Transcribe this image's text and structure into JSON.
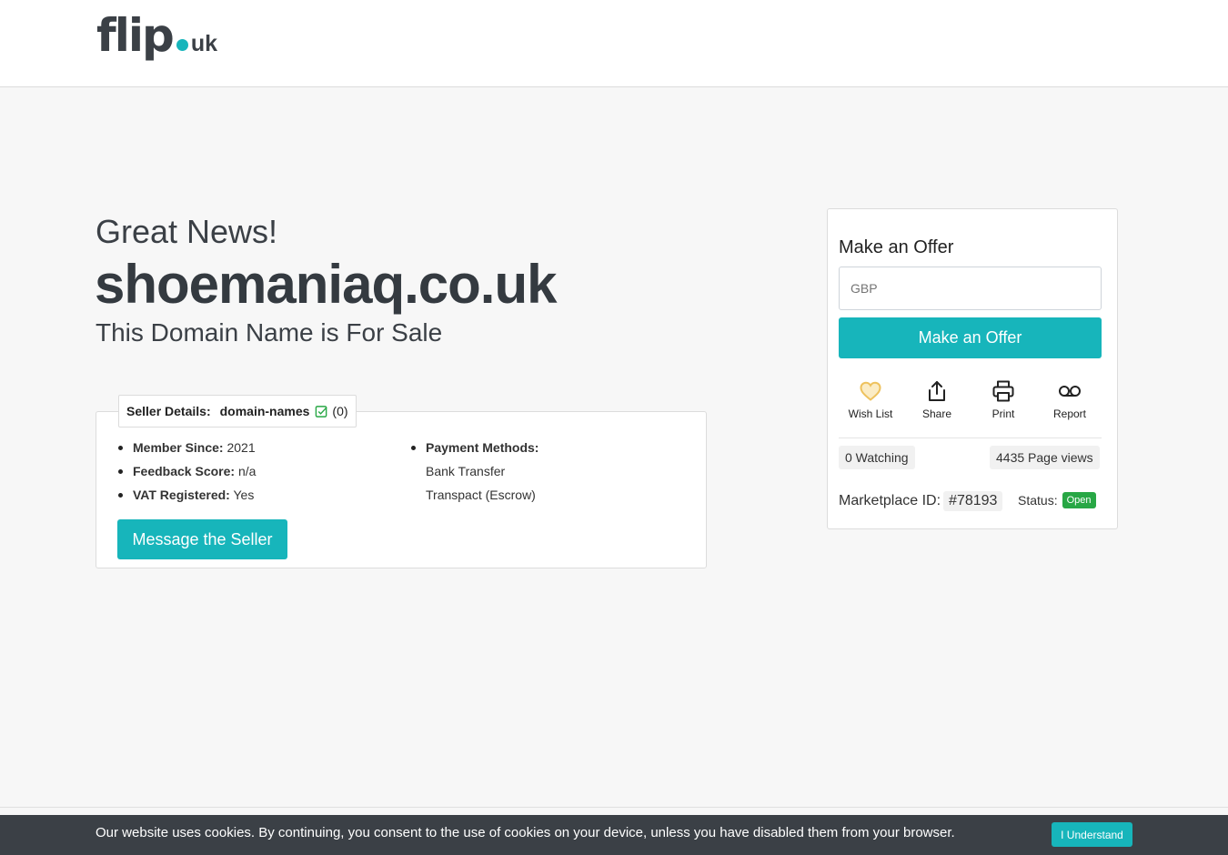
{
  "brand": {
    "name": "flip",
    "tld": "uk",
    "accent": "#17b5bb",
    "dark": "#3b4046"
  },
  "hero": {
    "kicker": "Great News!",
    "domain": "shoemaniaq.co.uk",
    "subtitle": "This Domain Name is For Sale"
  },
  "seller": {
    "details_label": "Seller Details:",
    "name": "domain-names",
    "verified_icon": "check-square-icon",
    "rating": "(0)",
    "facts": [
      {
        "key": "Member Since:",
        "value": "2021"
      },
      {
        "key": "Feedback Score:",
        "value": "n/a"
      },
      {
        "key": "VAT Registered:",
        "value": "Yes"
      }
    ],
    "payment_label": "Payment Methods:",
    "payment_methods": [
      "Bank Transfer",
      "Transpact (Escrow)"
    ],
    "message_button": "Message the Seller"
  },
  "offer": {
    "title": "Make an Offer",
    "currency_placeholder": "GBP",
    "button": "Make an Offer",
    "actions": [
      {
        "label": "Wish List",
        "icon": "heart-icon"
      },
      {
        "label": "Share",
        "icon": "share-icon"
      },
      {
        "label": "Print",
        "icon": "printer-icon"
      },
      {
        "label": "Report",
        "icon": "voicemail-icon"
      }
    ],
    "watching": "0 Watching",
    "page_views": "4435 Page views",
    "marketplace_label": "Marketplace ID:",
    "marketplace_id": "#78193",
    "status_label": "Status:",
    "status_value": "Open",
    "status_color": "#28a745"
  },
  "cookie": {
    "text": "Our website uses cookies. By continuing, you consent to the use of cookies on your device, unless you have disabled them from your browser.",
    "button": "I Understand"
  }
}
